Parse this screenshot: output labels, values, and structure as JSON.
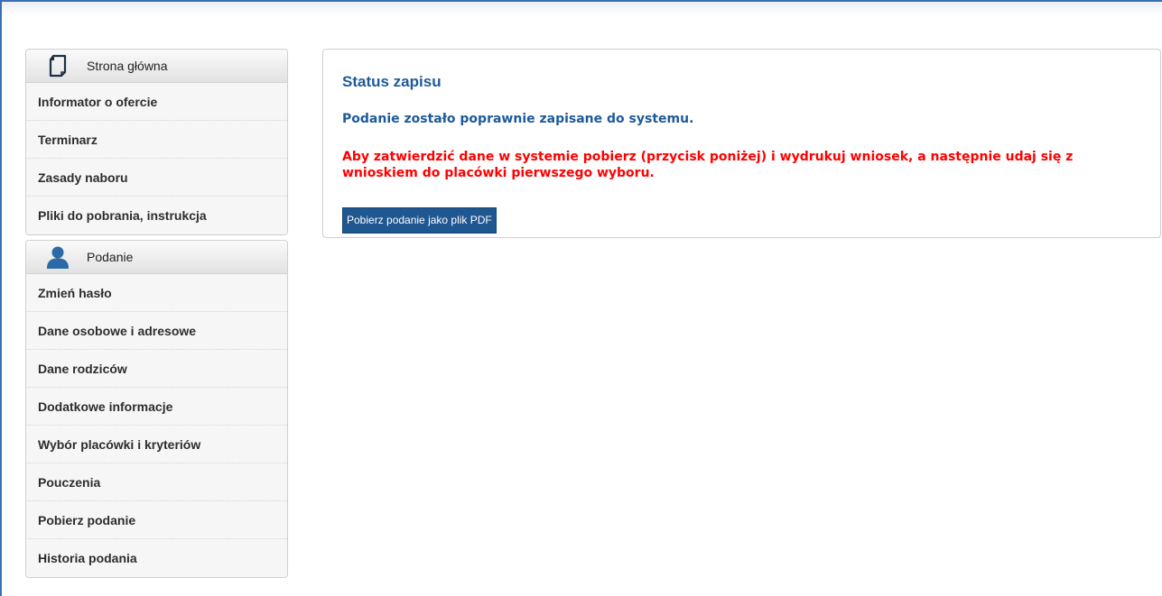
{
  "sidebar": {
    "section_main": {
      "title": "Strona główna",
      "icon": "document-icon",
      "items": [
        {
          "label": "Informator o ofercie"
        },
        {
          "label": "Terminarz"
        },
        {
          "label": "Zasady naboru"
        },
        {
          "label": "Pliki do pobrania, instrukcja"
        }
      ]
    },
    "section_application": {
      "title": "Podanie",
      "icon": "user-icon",
      "items": [
        {
          "label": "Zmień hasło"
        },
        {
          "label": "Dane osobowe i adresowe"
        },
        {
          "label": "Dane rodziców"
        },
        {
          "label": "Dodatkowe informacje"
        },
        {
          "label": "Wybór placówki i kryteriów"
        },
        {
          "label": "Pouczenia"
        },
        {
          "label": "Pobierz podanie"
        },
        {
          "label": "Historia podania"
        }
      ]
    }
  },
  "main": {
    "heading": "Status zapisu",
    "success_message": "Podanie zostało poprawnie zapisane do systemu.",
    "warning_message": "Aby zatwierdzić dane w systemie pobierz (przycisk poniżej) i wydrukuj wniosek, a następnie udaj się z wnioskiem do placówki pierwszego wyboru.",
    "pdf_button_label": "Pobierz podanie jako plik PDF"
  },
  "colors": {
    "heading_blue": "#1e5a99",
    "warning_red": "#ff0000",
    "button_blue": "#1f5791"
  }
}
